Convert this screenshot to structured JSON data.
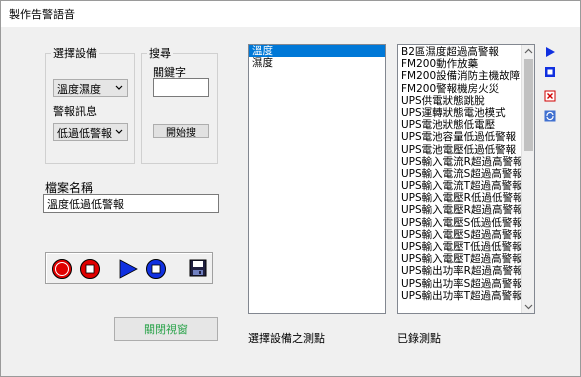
{
  "window": {
    "title": "製作告警語音"
  },
  "device_group": {
    "label": "選擇設備",
    "device_select": "溫度濕度",
    "alarm_label": "警報訊息",
    "alarm_select": "低過低警報"
  },
  "search_group": {
    "label": "搜尋",
    "keyword_label": "關鍵字",
    "keyword_value": "",
    "start_button": "開始搜"
  },
  "file": {
    "label": "檔案名稱",
    "filename": "溫度低過低警報"
  },
  "close_button": "關閉視窗",
  "points_list": {
    "items": [
      "溫度",
      "濕度"
    ],
    "selected_index": 0,
    "caption": "選擇設備之測點"
  },
  "recorded_list": {
    "items": [
      "B2區濕度超過高警報",
      "FM200動作放藥",
      "FM200設備消防主機故障",
      "FM200警報機房火災",
      "UPS供電狀態跳脫",
      "UPS運轉狀態電池模式",
      "UPS電池狀態低電壓",
      "UPS電池容量低過低警報",
      "UPS電池電壓低過低警報",
      "UPS輸入電流R超過高警報",
      "UPS輸入電流S超過高警報",
      "UPS輸入電流T超過高警報",
      "UPS輸入電壓R低過低警報",
      "UPS輸入電壓R超過高警報",
      "UPS輸入電壓S低過低警報",
      "UPS輸入電壓S超過高警報",
      "UPS輸入電壓T低過低警報",
      "UPS輸入電壓T超過高警報",
      "UPS輸出功率R超過高警報",
      "UPS輸出功率S超過高警報",
      "UPS輸出功率T超過高警報"
    ],
    "caption": "已錄測點"
  },
  "colors": {
    "selection": "#0078d7",
    "record_red": "#e00000",
    "play_blue": "#1030e0",
    "close_button_text": "#2aa34a"
  }
}
